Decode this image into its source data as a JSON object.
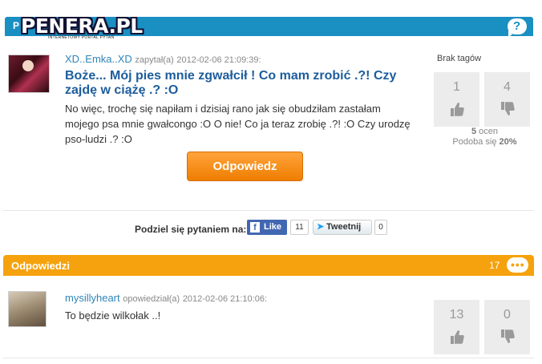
{
  "header": {
    "logo_text": "PENERA.PL",
    "logo_tagline": "INTERNETOWY PORTAL PYTAŃ",
    "bar_text": "P",
    "help_label": "?"
  },
  "question": {
    "author": "XD..Emka..XD",
    "asked_label": "zapytał(a)",
    "timestamp": "2012-02-06 21:09:39:",
    "title": "Boże... Mój pies mnie zgwałcił ! Co mam zrobić .?! Czy zajdę w ciążę .? :O",
    "body": "No więc, trochę się napiłam i dzisiaj rano jak się obudziłam zastałam mojego psa mnie gwałcongo :O O nie! Co ja teraz zrobię .?! :O Czy urodzę pso-ludzi .? :O",
    "answer_button": "Odpowiedz",
    "tags_label": "Brak tagów",
    "votes_up": "1",
    "votes_down": "4",
    "ratings_count": "5",
    "ratings_label": "ocen",
    "like_label": "Podoba się",
    "like_percent": "20%"
  },
  "share": {
    "label": "Podziel się pytaniem na:",
    "fb_label": "Like",
    "fb_count": "11",
    "tw_label": "Tweetnij",
    "tw_count": "0"
  },
  "answers": {
    "title": "Odpowiedzi",
    "count": "17",
    "items": [
      {
        "author": "mysillyheart",
        "answered_label": "opowiedział(a)",
        "timestamp": "2012-02-06 21:10:06:",
        "body": "To będzie wilkołak ..!",
        "votes_up": "13",
        "votes_down": "0"
      }
    ]
  },
  "colors": {
    "header_blue": "#1a8fc2",
    "answers_orange": "#f6a20e",
    "button_orange": "#ef7d00",
    "link_blue": "#2e86b9"
  }
}
